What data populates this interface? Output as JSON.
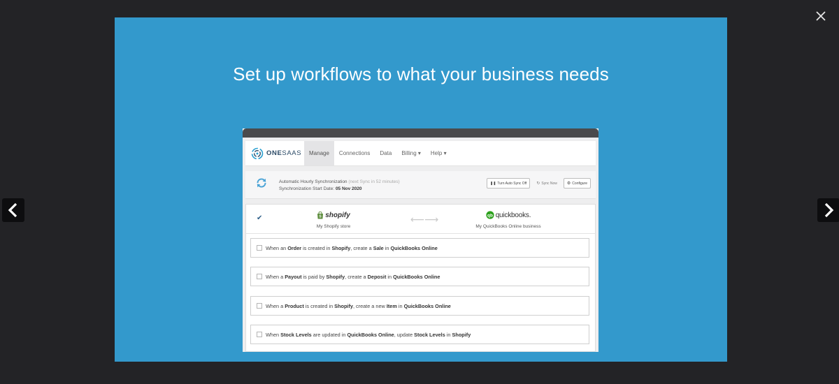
{
  "viewer": {
    "close_icon": "close-icon",
    "prev_icon": "chevron-left-icon",
    "next_icon": "chevron-right-icon"
  },
  "slide": {
    "title": "Set up workflows to what your business needs",
    "background": "#3399cc"
  },
  "app": {
    "logo": {
      "bold": "ONE",
      "light": "SAAS"
    },
    "nav": {
      "manage": "Manage",
      "connections": "Connections",
      "data": "Data",
      "billing": "Billing ▾",
      "help": "Help ▾"
    },
    "sync": {
      "line1_label": "Automatic Hourly Synchronization",
      "line1_muted": "(next Sync in 52 minutes)",
      "line2_label": "Synchronization Start Date:",
      "line2_value": "05 Nov 2020",
      "btn_turn_off": "Turn Auto Sync Off",
      "btn_sync_now": "Sync Now",
      "btn_configure": "Configure"
    },
    "connector": {
      "left_brand": "shopify",
      "left_caption": "My Shopify store",
      "right_brand": "quickbooks.",
      "right_caption": "My QuickBooks Online business",
      "arrows": "⟵⟶"
    },
    "rules": [
      {
        "p1": "When an ",
        "b1": "Order",
        "p2": " is created in ",
        "b2": "Shopify",
        "p3": ", create a ",
        "b3": "Sale",
        "p4": " in ",
        "b4": "QuickBooks Online",
        "p5": "",
        "b5": ""
      },
      {
        "p1": "When a ",
        "b1": "Payout",
        "p2": " is paid by ",
        "b2": "Shopify",
        "p3": ", create a ",
        "b3": "Deposit",
        "p4": " in ",
        "b4": "QuickBooks Online",
        "p5": "",
        "b5": ""
      },
      {
        "p1": "When a ",
        "b1": "Product",
        "p2": " is created in ",
        "b2": "Shopify",
        "p3": ", create a new ",
        "b3": "Item",
        "p4": " in ",
        "b4": "QuickBooks Online",
        "p5": "",
        "b5": ""
      },
      {
        "p1": "When ",
        "b1": "Stock Levels",
        "p2": " are updated in ",
        "b2": "QuickBooks Online",
        "p3": ", update ",
        "b3": "Stock Levels",
        "p4": " in ",
        "b4": "Shopify",
        "p5": "",
        "b5": ""
      }
    ]
  }
}
